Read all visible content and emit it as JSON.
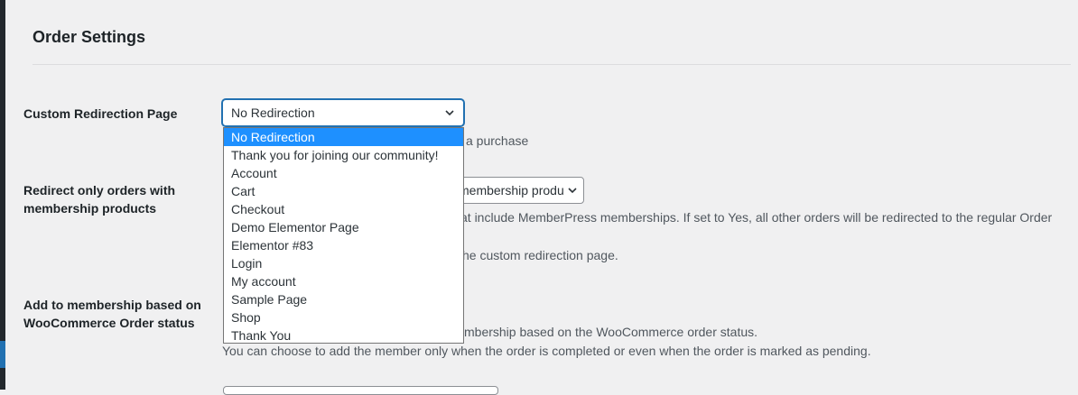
{
  "section": {
    "heading": "Order Settings"
  },
  "fields": {
    "redirect_page": {
      "label": "Custom Redirection Page",
      "selected": "No Redirection",
      "description_partial": "a purchase",
      "options": [
        "No Redirection",
        "Thank you for joining our community!",
        "Account",
        "Cart",
        "Checkout",
        "Demo Elementor Page",
        "Elementor #83",
        "Login",
        "My account",
        "Sample Page",
        "Shop",
        "Thank You"
      ]
    },
    "redirect_membership_only": {
      "label_line1": "Redirect only orders with",
      "label_line2": "membership products",
      "selected_partial": "membership produ",
      "description_line1_partial": "at include MemberPress memberships. If set to Yes, all other orders will be redirected to the regular Order",
      "description_line2_partial": "he custom redirection page."
    },
    "add_membership_status": {
      "label_line1": "Add to membership based on",
      "label_line2": "WooCommerce Order status",
      "description_line1_partial": "mbership based on the WooCommerce order status.",
      "description_line2": "You can choose to add the member only when the order is completed or even when the order is marked as pending."
    }
  },
  "icons": {
    "select_arrow": "chevron-down-icon"
  }
}
